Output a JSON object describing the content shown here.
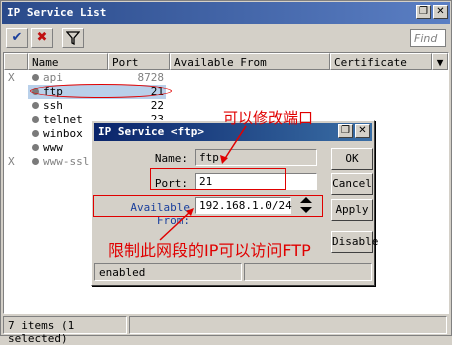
{
  "window": {
    "title": "IP Service List"
  },
  "toolbar": {
    "find_placeholder": "Find"
  },
  "columns": [
    "Name",
    "Port",
    "Available From",
    "Certificate"
  ],
  "rows": [
    {
      "flag": "X",
      "name": "api",
      "port": "8728",
      "available_from": "",
      "disabled": true
    },
    {
      "flag": "",
      "name": "ftp",
      "port": "21",
      "available_from": "",
      "disabled": false,
      "selected": true
    },
    {
      "flag": "",
      "name": "ssh",
      "port": "22",
      "available_from": "",
      "disabled": false
    },
    {
      "flag": "",
      "name": "telnet",
      "port": "23",
      "available_from": "",
      "disabled": false
    },
    {
      "flag": "",
      "name": "winbox",
      "port": "",
      "available_from": "",
      "disabled": false
    },
    {
      "flag": "",
      "name": "www",
      "port": "",
      "available_from": "",
      "disabled": false
    },
    {
      "flag": "X",
      "name": "www-ssl",
      "port": "",
      "available_from": "",
      "disabled": true
    }
  ],
  "status": {
    "items": "7 items (1 selected)"
  },
  "dialog": {
    "title": "IP Service <ftp>",
    "name_label": "Name:",
    "name_value": "ftp",
    "port_label": "Port:",
    "port_value": "21",
    "available_label": "Available From:",
    "available_value": "192.168.1.0/24",
    "status": "enabled",
    "buttons": {
      "ok": "OK",
      "cancel": "Cancel",
      "apply": "Apply",
      "disable": "Disable"
    }
  },
  "annotations": {
    "port_note": "可以修改端口",
    "ip_note": "限制此网段的IP可以访问FTP"
  },
  "colors": {
    "titlebar": "#2a4a8a",
    "annotation": "#e00000",
    "selection": "#b9d0ea"
  }
}
